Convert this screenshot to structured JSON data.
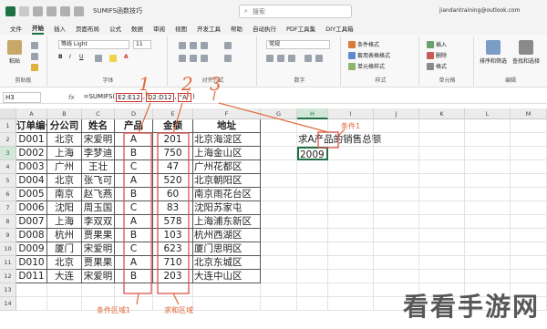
{
  "titlebar": {
    "doc_title": "SUMIFS函数技巧",
    "search_placeholder": "搜索",
    "account": "jiandantraining@outlook.com"
  },
  "tabs": [
    "文件",
    "开始",
    "插入",
    "页面布局",
    "公式",
    "数据",
    "审阅",
    "视图",
    "开发工具",
    "帮助",
    "自动执行",
    "PDF工具集",
    "DIY工具箱"
  ],
  "ribbon": {
    "paste": "粘贴",
    "clipboard": "剪贴板",
    "font_name": "等线 Light",
    "font_size": "11",
    "font_group": "字体",
    "align_group": "对齐方式",
    "number_format": "常规",
    "number_group": "数字",
    "cond_format": "条件格式",
    "table_format": "套用表格格式",
    "cell_style": "单元格样式",
    "style_group": "样式",
    "insert": "插入",
    "delete": "删除",
    "format": "格式",
    "cells_group": "单元格",
    "sort_filter": "排序和筛选",
    "find_select": "查找和选择",
    "edit_group": "编辑"
  },
  "formula_bar": {
    "name_box": "H3",
    "fx": "fx",
    "formula_prefix": "=SUMIFS(",
    "arg1": "E2:E12",
    "arg2": "D2:D12",
    "arg3": "\"A\"",
    "formula_suffix": ")"
  },
  "grid": {
    "columns": [
      "A",
      "B",
      "C",
      "D",
      "E",
      "F",
      "G",
      "H",
      "I",
      "J",
      "K",
      "L",
      "M"
    ],
    "rows": [
      "1",
      "2",
      "3",
      "4",
      "5",
      "6",
      "7",
      "8",
      "9",
      "10",
      "11",
      "12",
      "13",
      "14"
    ],
    "headers": [
      "订单编号",
      "分公司",
      "姓名",
      "产品",
      "金额",
      "地址"
    ],
    "data": [
      [
        "D001",
        "北京",
        "宋爱明",
        "A",
        "201",
        "北京海淀区"
      ],
      [
        "D002",
        "上海",
        "李梦迪",
        "B",
        "750",
        "上海金山区"
      ],
      [
        "D003",
        "广州",
        "王壮",
        "C",
        "47",
        "广州花都区"
      ],
      [
        "D004",
        "北京",
        "张飞可",
        "A",
        "520",
        "北京朝阳区"
      ],
      [
        "D005",
        "南京",
        "赵飞燕",
        "B",
        "60",
        "南京雨花台区"
      ],
      [
        "D006",
        "沈阳",
        "周玉国",
        "C",
        "83",
        "沈阳苏家屯"
      ],
      [
        "D007",
        "上海",
        "李双双",
        "A",
        "578",
        "上海浦东新区"
      ],
      [
        "D008",
        "杭州",
        "贾果果",
        "B",
        "103",
        "杭州西湖区"
      ],
      [
        "D009",
        "厦门",
        "宋爱明",
        "C",
        "623",
        "厦门思明区"
      ],
      [
        "D010",
        "北京",
        "贾果果",
        "A",
        "710",
        "北京东城区"
      ],
      [
        "D011",
        "大连",
        "宋爱明",
        "B",
        "203",
        "大连中山区"
      ]
    ],
    "h2": "求A产品的销售总额",
    "h3": "2009"
  },
  "annotations": {
    "n1": "1",
    "n2": "2",
    "n3": "3",
    "cond1": "条件1",
    "cond_area": "条件区域1",
    "sum_area": "求和区域"
  },
  "watermark": "看看手游网"
}
